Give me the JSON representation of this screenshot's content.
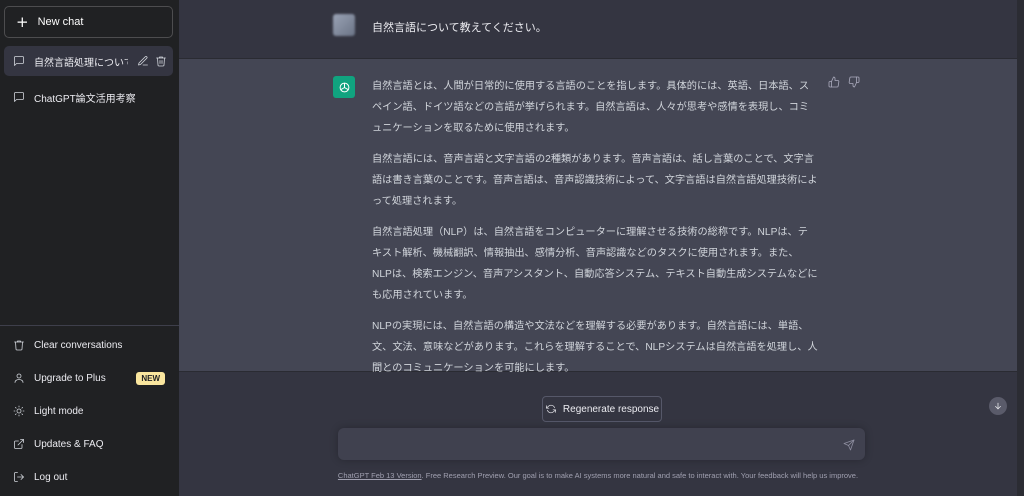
{
  "sidebar": {
    "new_chat": "New chat",
    "conversations": [
      {
        "title": "自然言語処理について",
        "active": true
      },
      {
        "title": "ChatGPT論文活用考察",
        "active": false
      }
    ],
    "bottom": {
      "clear": "Clear conversations",
      "upgrade": "Upgrade to Plus",
      "upgrade_badge": "NEW",
      "light_mode": "Light mode",
      "updates": "Updates & FAQ",
      "logout": "Log out"
    }
  },
  "chat": {
    "user_message": "自然言語について教えてください。",
    "assistant_paragraphs": [
      "自然言語とは、人間が日常的に使用する言語のことを指します。具体的には、英語、日本語、スペイン語、ドイツ語などの言語が挙げられます。自然言語は、人々が思考や感情を表現し、コミュニケーションを取るために使用されます。",
      "自然言語には、音声言語と文字言語の2種類があります。音声言語は、話し言葉のことで、文字言語は書き言葉のことです。音声言語は、音声認識技術によって、文字言語は自然言語処理技術によって処理されます。",
      "自然言語処理（NLP）は、自然言語をコンピューターに理解させる技術の総称です。NLPは、テキスト解析、機械翻訳、情報抽出、感情分析、音声認識などのタスクに使用されます。また、NLPは、検索エンジン、音声アシスタント、自動応答システム、テキスト自動生成システムなどにも応用されています。",
      "NLPの実現には、自然言語の構造や文法などを理解する必要があります。自然言語には、単語、文、文法、意味などがあります。これらを理解することで、NLPシステムは自然言語を処理し、人間とのコミュニケーションを可能にします。"
    ],
    "regenerate": "Regenerate response",
    "input_placeholder": ""
  },
  "footer": {
    "link": "ChatGPT Feb 13 Version",
    "text": ". Free Research Preview. Our goal is to make AI systems more natural and safe to interact with. Your feedback will help us improve."
  },
  "colors": {
    "sidebar_bg": "#202123",
    "main_bg": "#343541",
    "assistant_bg": "#444654",
    "bot_avatar": "#10a37f",
    "badge": "#fae69e"
  }
}
